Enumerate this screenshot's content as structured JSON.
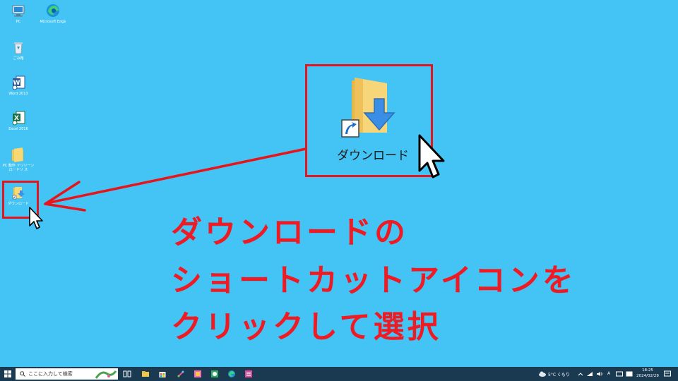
{
  "desktop_icons": [
    {
      "name": "pc",
      "label": "PC"
    },
    {
      "name": "edge",
      "label": "Microsoft Edge"
    },
    {
      "name": "recycle-bin",
      "label": "ごみ箱"
    },
    {
      "name": "word",
      "label": "Word 2013"
    },
    {
      "name": "excel",
      "label": "Excel 2016"
    },
    {
      "name": "folder-shortcut",
      "label": "PC 動作 ドリリーン ロードリ ス"
    },
    {
      "name": "download-shortcut",
      "label": "ダウンロード"
    }
  ],
  "highlight": {
    "label": "ダウンロード"
  },
  "instruction": {
    "line1": "ダウンロードの",
    "line2": "ショートカットアイコンを",
    "line3": "クリックして選択"
  },
  "taskbar": {
    "search_placeholder": "ここに入力して検索",
    "weather": "5°C くもり",
    "ime": "A",
    "time": "18:25",
    "date": "2024/02/29"
  },
  "colors": {
    "desktop": "#43c4f4",
    "annotation": "#e8141c",
    "taskbar": "#1a3a52"
  }
}
